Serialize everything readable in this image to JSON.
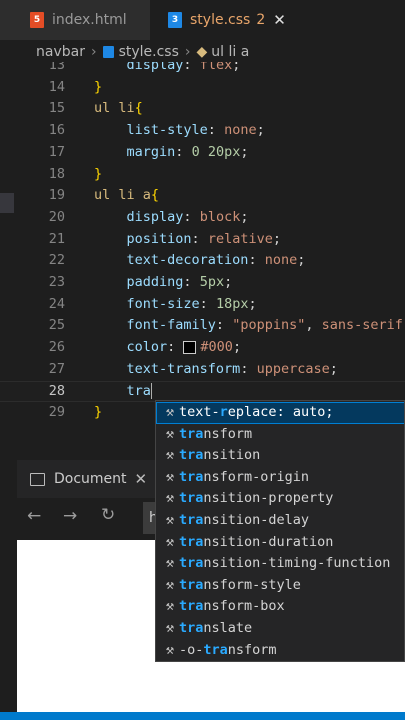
{
  "tabs": [
    {
      "name": "index.html",
      "icon": "html5-icon"
    },
    {
      "name": "style.css",
      "icon": "css3-icon",
      "problems": "2",
      "close": "✕"
    }
  ],
  "breadcrumb": {
    "folder": "navbar",
    "file": "style.css",
    "symbol": "ul li a"
  },
  "editor": {
    "lines": [
      {
        "num": "13",
        "html": "    <span class=\"prop\">display</span><span class=\"pl\">: </span><span class=\"val\">flex</span><span class=\"pl\">;</span>"
      },
      {
        "num": "14",
        "html": "<span class=\"br\">}</span>"
      },
      {
        "num": "15",
        "html": "<span class=\"sel\">ul li</span><span class=\"br\">{</span>"
      },
      {
        "num": "16",
        "html": "    <span class=\"prop\">list-style</span><span class=\"pl\">: </span><span class=\"val\">none</span><span class=\"pl\">;</span>"
      },
      {
        "num": "17",
        "html": "    <span class=\"prop\">margin</span><span class=\"pl\">: </span><span class=\"num\">0 20px</span><span class=\"pl\">;</span>"
      },
      {
        "num": "18",
        "html": "<span class=\"br\">}</span>"
      },
      {
        "num": "19",
        "html": "<span class=\"sel\">ul li a</span><span class=\"br\">{</span>"
      },
      {
        "num": "20",
        "html": "    <span class=\"prop\">display</span><span class=\"pl\">: </span><span class=\"val\">block</span><span class=\"pl\">;</span>"
      },
      {
        "num": "21",
        "html": "    <span class=\"prop\">position</span><span class=\"pl\">: </span><span class=\"val\">relative</span><span class=\"pl\">;</span>"
      },
      {
        "num": "22",
        "html": "    <span class=\"prop\">text-decoration</span><span class=\"pl\">: </span><span class=\"val\">none</span><span class=\"pl\">;</span>"
      },
      {
        "num": "23",
        "html": "    <span class=\"prop\">padding</span><span class=\"pl\">: </span><span class=\"num\">5px</span><span class=\"pl\">;</span>"
      },
      {
        "num": "24",
        "html": "    <span class=\"prop\">font-size</span><span class=\"pl\">: </span><span class=\"num\">18px</span><span class=\"pl\">;</span>"
      },
      {
        "num": "25",
        "html": "    <span class=\"prop\">font-family</span><span class=\"pl\">: </span><span class=\"val\">\"poppins\"</span><span class=\"pl\">, </span><span class=\"val\">sans-serif</span><span class=\"pl\">;</span>"
      },
      {
        "num": "26",
        "html": "    <span class=\"prop\">color</span><span class=\"pl\">: </span><span class=\"swatch\"></span><span class=\"val\">#000</span><span class=\"pl\">;</span>"
      },
      {
        "num": "27",
        "html": "    <span class=\"prop\">text-transform</span><span class=\"pl\">: </span><span class=\"val\">uppercase</span><span class=\"pl\">;</span>"
      },
      {
        "num": "28",
        "html": "    <span class=\"prop\">tra</span><span class=\"cursor\"></span>",
        "active": true
      },
      {
        "num": "29",
        "html": "<span class=\"br\">}</span>"
      }
    ]
  },
  "suggestions": [
    {
      "pre": "text-",
      "match": "r",
      "mid": "eplace",
      "post": ": auto;",
      "selected": true
    },
    {
      "pre": "",
      "match": "tra",
      "mid": "nsform",
      "post": ""
    },
    {
      "pre": "",
      "match": "tra",
      "mid": "nsition",
      "post": ""
    },
    {
      "pre": "",
      "match": "tra",
      "mid": "nsform-origin",
      "post": ""
    },
    {
      "pre": "",
      "match": "tra",
      "mid": "nsition-property",
      "post": ""
    },
    {
      "pre": "",
      "match": "tra",
      "mid": "nsition-delay",
      "post": ""
    },
    {
      "pre": "",
      "match": "tra",
      "mid": "nsition-duration",
      "post": ""
    },
    {
      "pre": "",
      "match": "tra",
      "mid": "nsition-timing-function",
      "post": ""
    },
    {
      "pre": "",
      "match": "tra",
      "mid": "nsform-style",
      "post": ""
    },
    {
      "pre": "",
      "match": "tra",
      "mid": "nsform-box",
      "post": ""
    },
    {
      "pre": "",
      "match": "tra",
      "mid": "nslate",
      "post": ""
    },
    {
      "pre": "-o-",
      "match": "tra",
      "mid": "nsform",
      "post": ""
    }
  ],
  "panel": {
    "title": "Document",
    "close": "✕",
    "url": "http"
  },
  "colors": {
    "accent": "#007acc",
    "selection": "#04395e",
    "match": "#2aaaff"
  }
}
